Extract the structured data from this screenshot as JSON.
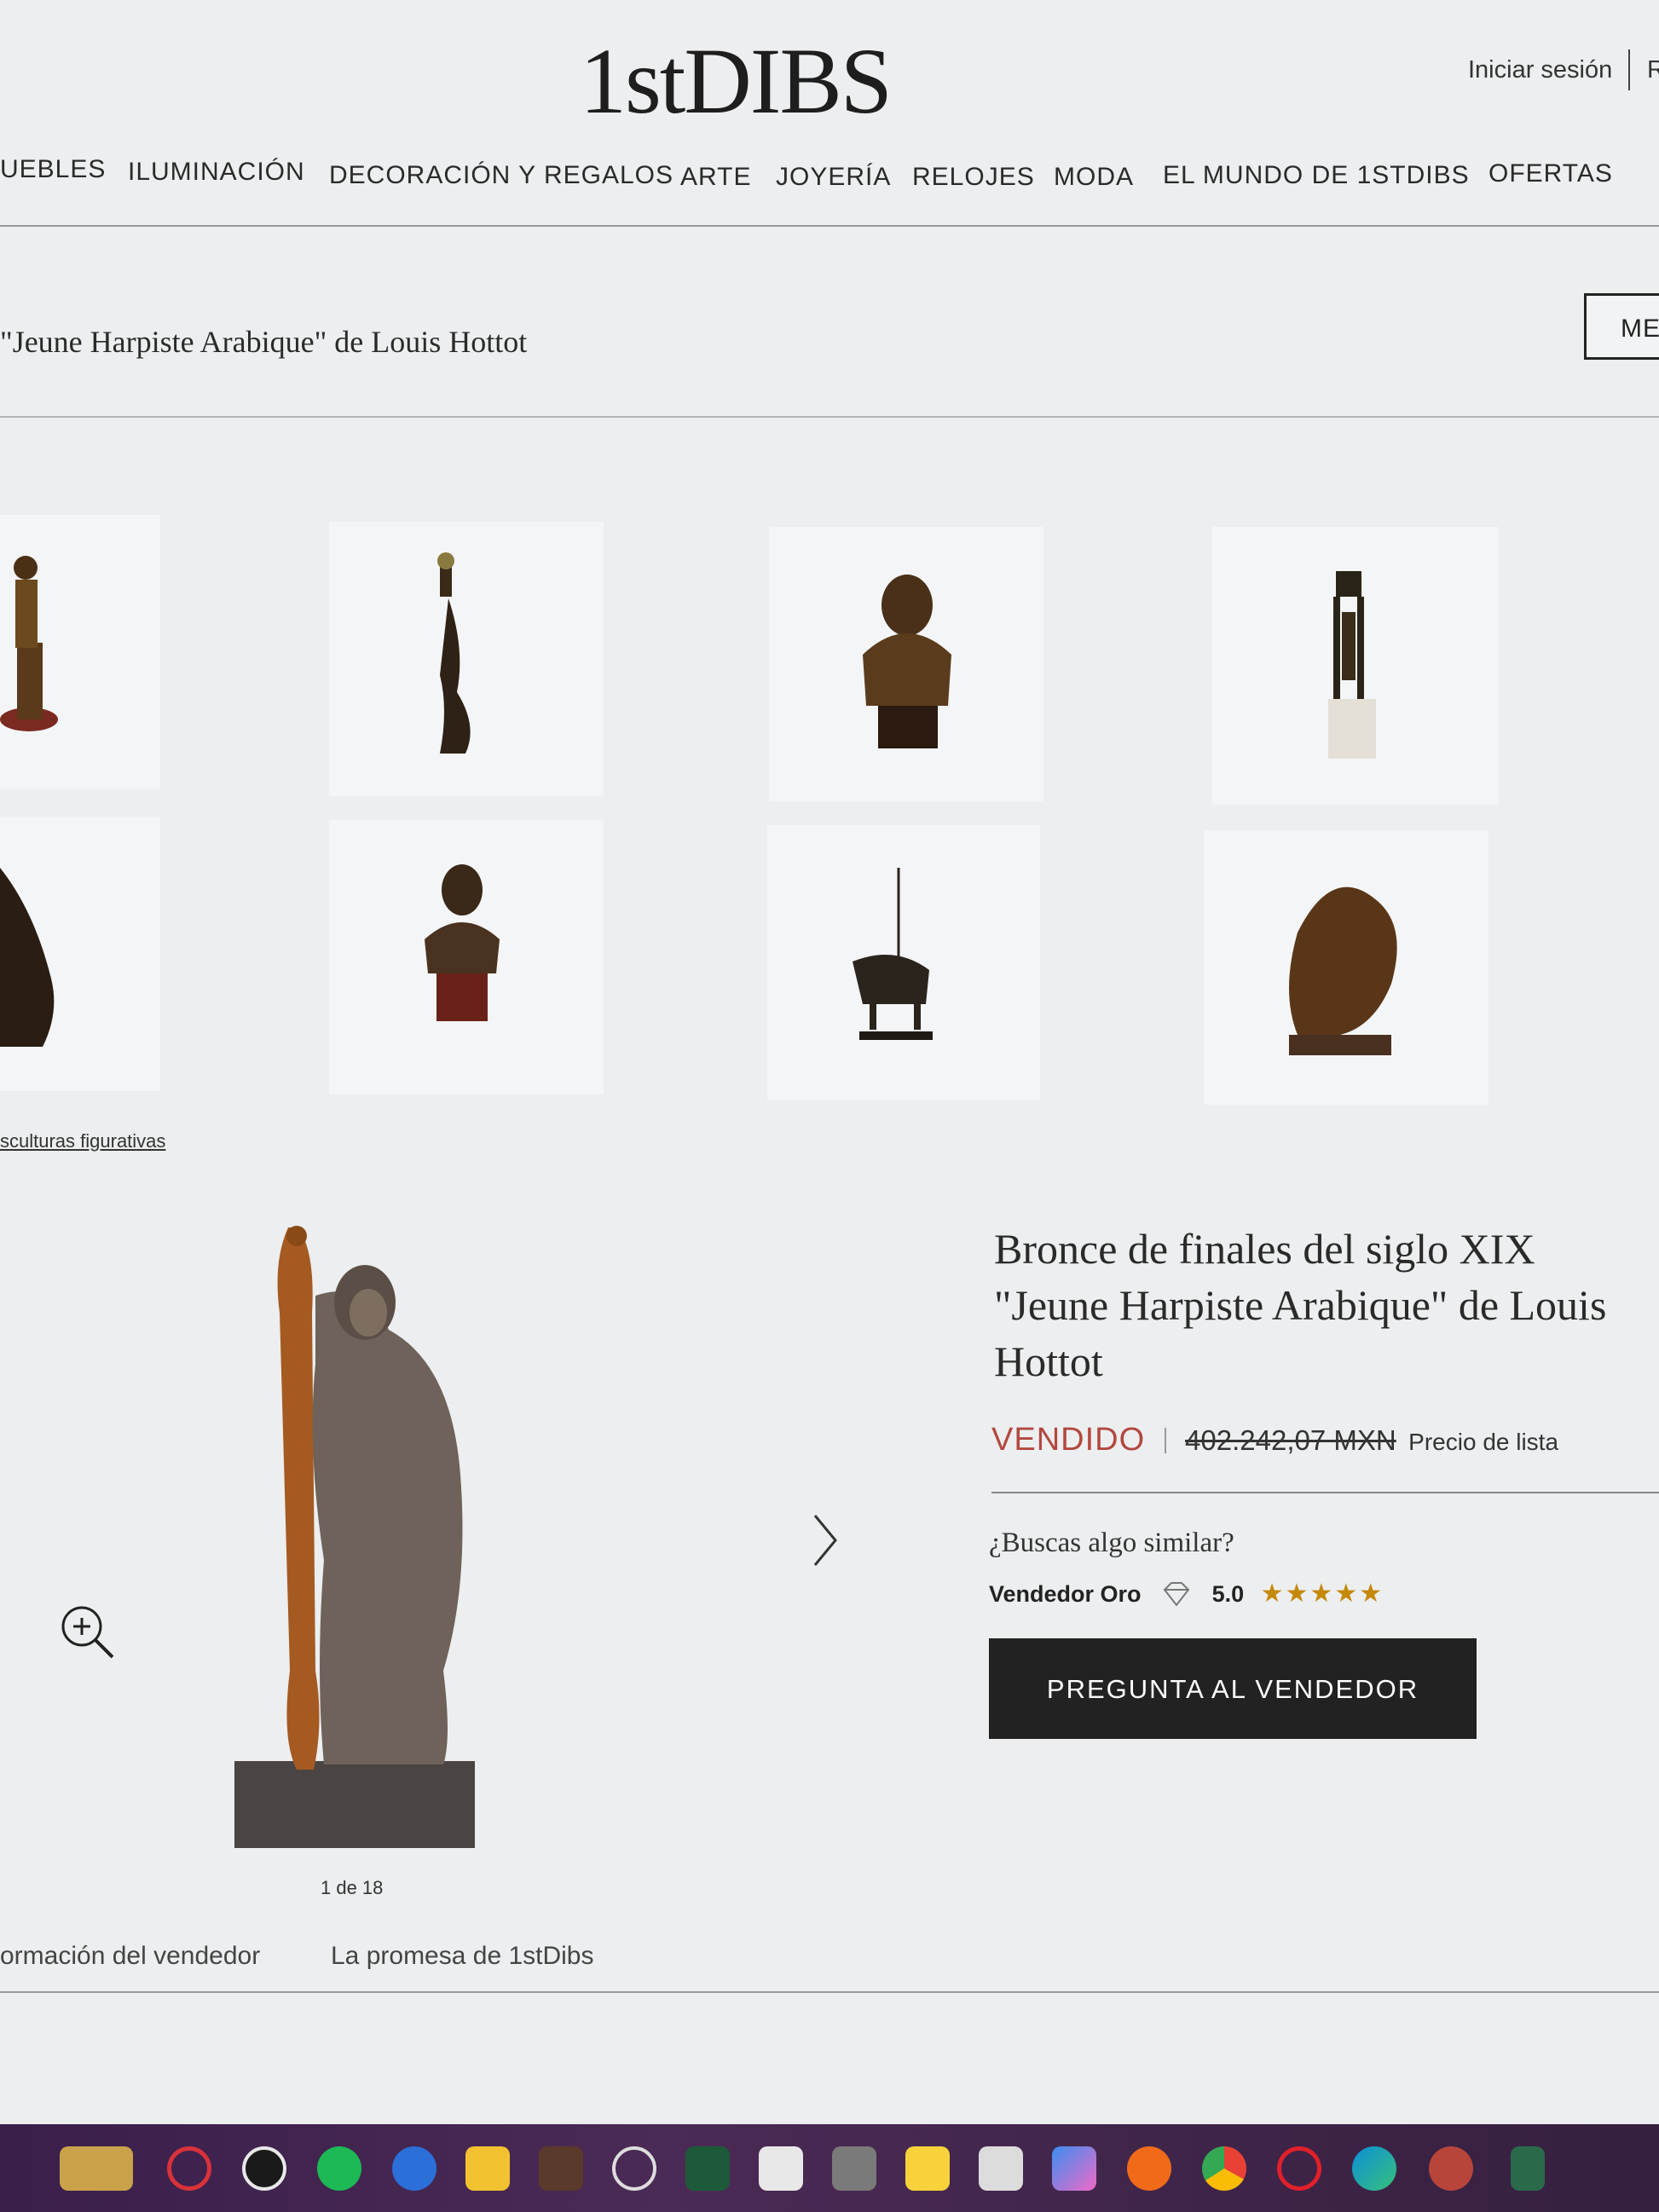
{
  "header": {
    "logo_text": "1stDIBS",
    "signin": "Iniciar sesión",
    "register_partial": "R"
  },
  "nav": {
    "items": [
      "UEBLES",
      "ILUMINACIÓN",
      "DECORACIÓN Y REGALOS",
      "ARTE",
      "JOYERÍA",
      "RELOJES",
      "MODA",
      "EL MUNDO DE 1STDIBS",
      "OFERTAS"
    ]
  },
  "breadcrumb": {
    "title": "\"Jeune Harpiste Arabique\" de Louis Hottot",
    "menu_button": "ME"
  },
  "related": {
    "category_link": "sculturas figurativas"
  },
  "product": {
    "title": "Bronce de finales del siglo XIX \"Jeune Harpiste Arabique\" de Louis Hottot",
    "status": "VENDIDO",
    "price": "402.242,07 MXN",
    "price_label": "Precio de lista",
    "similar_prompt": "¿Buscas algo similar?",
    "seller_level": "Vendedor Oro",
    "seller_rating": "5.0",
    "stars": "★★★★★",
    "ask_button": "PREGUNTA AL VENDEDOR",
    "image_counter": "1 de 18"
  },
  "tabs": [
    "ormación del vendedor",
    "La promesa de 1stDibs"
  ],
  "taskbar_icons": [
    "games-icon",
    "opera-icon",
    "whatsapp-icon",
    "spotify-icon",
    "app-icon",
    "file-explorer-icon",
    "game-icon",
    "xbox-icon",
    "terminal-icon",
    "store-icon",
    "calculator-icon",
    "sticky-notes-icon",
    "snipping-tool-icon",
    "copilot-icon",
    "firefox-icon",
    "chrome-icon",
    "opera-gx-icon",
    "edge-icon",
    "settings-icon",
    "overflow-icon"
  ]
}
